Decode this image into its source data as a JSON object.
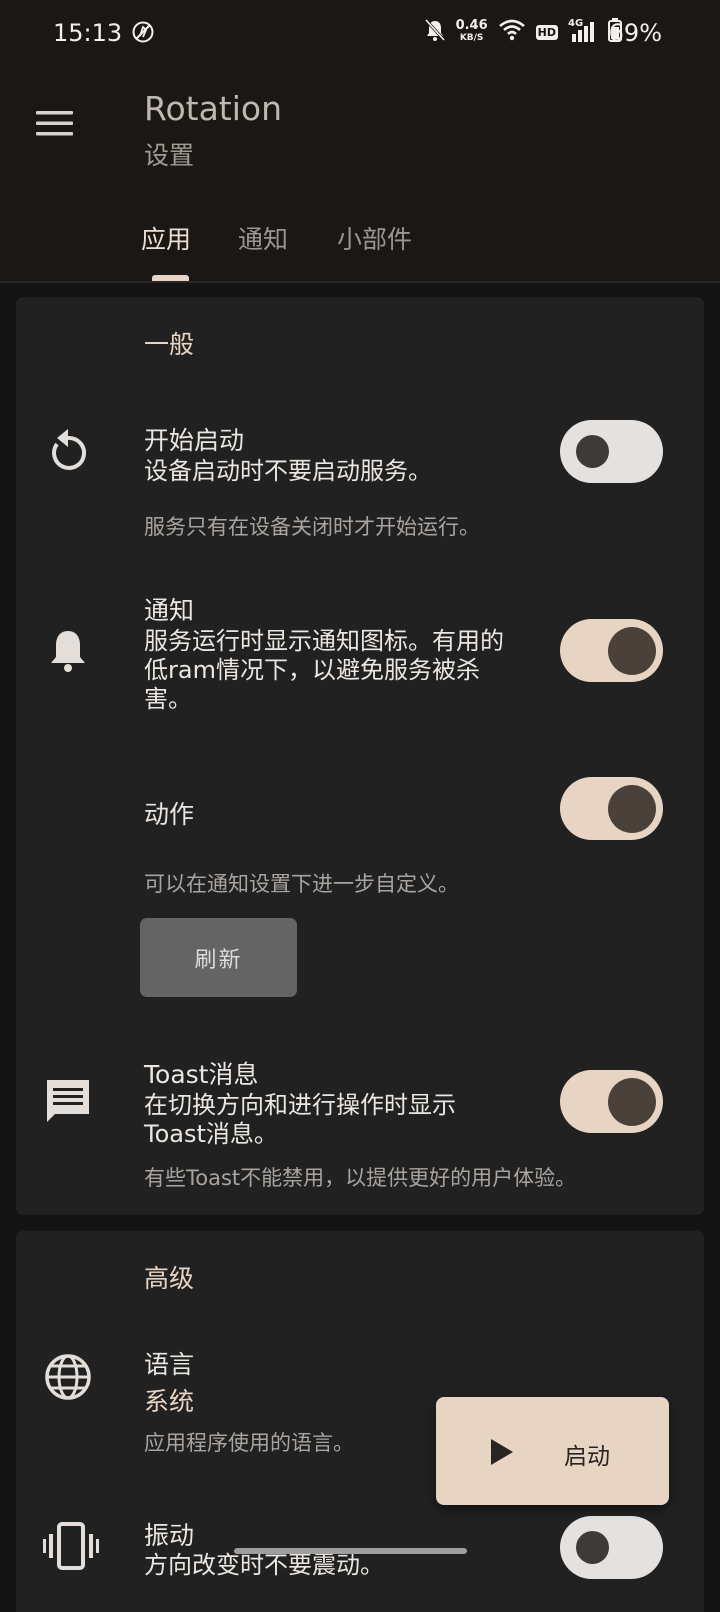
{
  "status_bar": {
    "time": "15:13",
    "net_speed_value": "0.46",
    "net_speed_unit": "KB/S",
    "hd": "HD",
    "network_type": "4G",
    "battery_percent": "69%",
    "battery_level": 0.69
  },
  "app_bar": {
    "title": "Rotation",
    "subtitle": "设置"
  },
  "tabs": [
    {
      "label": "应用",
      "active": true
    },
    {
      "label": "通知",
      "active": false
    },
    {
      "label": "小部件",
      "active": false
    }
  ],
  "general": {
    "section_title": "一般",
    "start_on_boot": {
      "title": "开始启动",
      "summary": "设备启动时不要启动服务。",
      "description": "服务只有在设备关闭时才开始运行。",
      "enabled": false
    },
    "notification": {
      "title": "通知",
      "summary": "服务运行时显示通知图标。有用的低ram情况下，以避免服务被杀害。",
      "enabled": true
    },
    "actions": {
      "title": "动作",
      "description": "可以在通知设置下进一步自定义。",
      "enabled": true,
      "refresh_label": "刷新"
    },
    "toast": {
      "title": "Toast消息",
      "summary": "在切换方向和进行操作时显示Toast消息。",
      "description": "有些Toast不能禁用，以提供更好的用户体验。",
      "enabled": true
    }
  },
  "advanced": {
    "section_title": "高级",
    "language": {
      "title": "语言",
      "value": "系统",
      "description": "应用程序使用的语言。"
    },
    "vibration": {
      "title": "振动",
      "summary": "方向改变时不要震动。",
      "enabled": false
    }
  },
  "fab": {
    "label": "启动"
  },
  "colors": {
    "accent": "#e8d4c2",
    "surface": "#212121",
    "background": "#141414",
    "app_bar": "#1a1714"
  }
}
